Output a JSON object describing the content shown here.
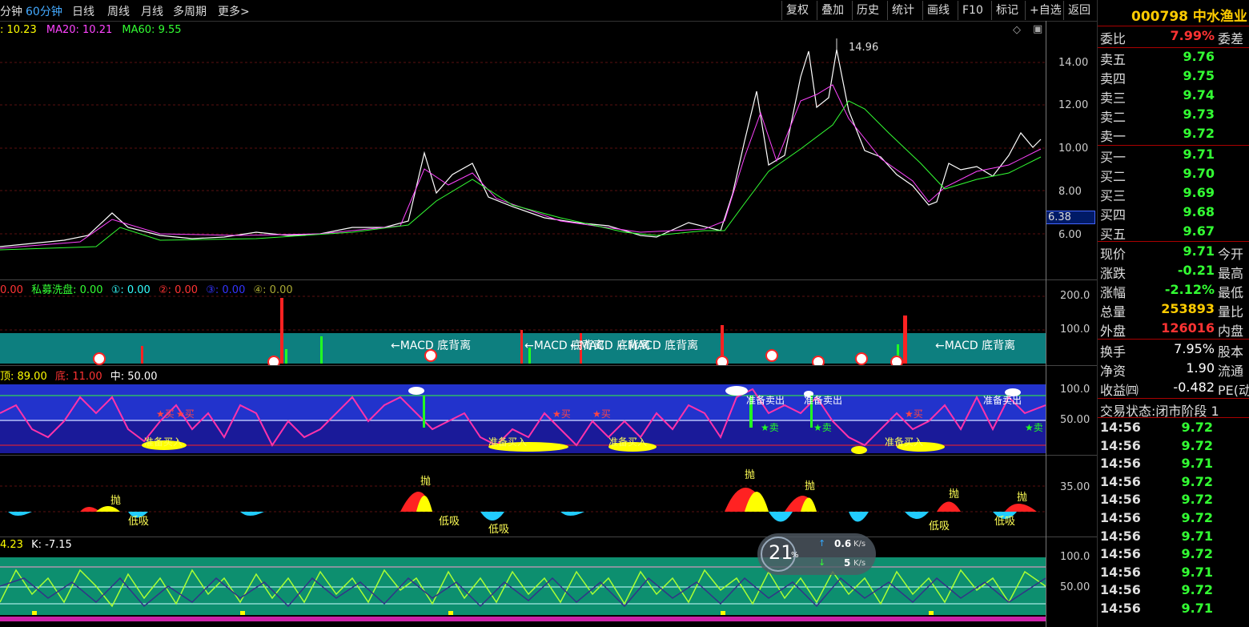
{
  "toolbar": {
    "tabs": [
      "分钟",
      "60分钟",
      "日线",
      "周线",
      "月线",
      "多周期",
      "更多>"
    ],
    "buttons": [
      "复权",
      "叠加",
      "历史",
      "统计",
      "画线",
      "F10",
      "标记",
      "+自选",
      "返回"
    ]
  },
  "main_chart": {
    "legend": [
      {
        "text": ": 10.23",
        "color": "#ffff00"
      },
      {
        "text": "MA20: 10.21",
        "color": "#ff44ff"
      },
      {
        "text": "MA60: 9.55",
        "color": "#33ff33"
      }
    ],
    "peak_label": "14.96",
    "y_ticks": [
      "14.00",
      "12.00",
      "10.00",
      "8.00",
      "6.00"
    ],
    "current_price_tag": "6.38"
  },
  "panel2": {
    "legend": [
      {
        "text": "0.00",
        "color": "#ff3333"
      },
      {
        "text": "私募洗盘: 0.00",
        "color": "#33ff33"
      },
      {
        "text": "①: 0.00",
        "color": "#33ffff"
      },
      {
        "text": "②: 0.00",
        "color": "#ff3333"
      },
      {
        "text": "③: 0.00",
        "color": "#3333ff"
      },
      {
        "text": "④: 0.00",
        "color": "#aaaa33"
      }
    ],
    "y_ticks": [
      "200.0",
      "100.0"
    ],
    "annotations": [
      "←MACD 底背离",
      "←MACD 底背离",
      "←MACD 底背离",
      "←MACD 底背离",
      "←MACD 底背离"
    ]
  },
  "panel3": {
    "legend": [
      {
        "text": "顶: 89.00",
        "color": "#ffff00"
      },
      {
        "text": "底: 11.00",
        "color": "#ff3333"
      },
      {
        "text": "中: 50.00",
        "color": "#ffffff"
      }
    ],
    "y_ticks": [
      "100.0",
      "50.00"
    ],
    "labels": {
      "buy": "准备买入",
      "sell": "准备卖出",
      "b": "★买",
      "s": "★卖"
    }
  },
  "panel4": {
    "y_ticks": [
      "35.00"
    ],
    "labels": {
      "throw": "抛",
      "absorb": "低吸"
    }
  },
  "panel5": {
    "legend": [
      {
        "text": "4.23",
        "color": "#ffff00"
      },
      {
        "text": "K: -7.15",
        "color": "#ffffff"
      }
    ],
    "y_ticks": [
      "100.0",
      "50.00"
    ]
  },
  "speed_widget": {
    "percent": "21",
    "unit": "%",
    "up": "0.6",
    "down": "5",
    "unit_rate": "K/s"
  },
  "quote": {
    "code_name": "000798 中水渔业",
    "weibi_label": "委比",
    "weibi_value": "7.99%",
    "weicha_label": "委差",
    "asks": [
      {
        "label": "卖五",
        "price": "9.76"
      },
      {
        "label": "卖四",
        "price": "9.75"
      },
      {
        "label": "卖三",
        "price": "9.74"
      },
      {
        "label": "卖二",
        "price": "9.73"
      },
      {
        "label": "卖一",
        "price": "9.72"
      }
    ],
    "bids": [
      {
        "label": "买一",
        "price": "9.71"
      },
      {
        "label": "买二",
        "price": "9.70"
      },
      {
        "label": "买三",
        "price": "9.69"
      },
      {
        "label": "买四",
        "price": "9.68"
      },
      {
        "label": "买五",
        "price": "9.67"
      }
    ],
    "stats": [
      {
        "label": "现价",
        "value": "9.71",
        "color": "#33ff33",
        "extra": "今开"
      },
      {
        "label": "涨跌",
        "value": "-0.21",
        "color": "#33ff33",
        "extra": "最高"
      },
      {
        "label": "涨幅",
        "value": "-2.12%",
        "color": "#33ff33",
        "extra": "最低"
      },
      {
        "label": "总量",
        "value": "253893",
        "color": "#ffff00",
        "extra": "量比"
      },
      {
        "label": "外盘",
        "value": "126016",
        "color": "#ff3333",
        "extra": "内盘"
      }
    ],
    "stats2": [
      {
        "label": "换手",
        "value": "7.95%",
        "extra": "股本"
      },
      {
        "label": "净资",
        "value": "1.90",
        "extra": "流通"
      },
      {
        "label": "收益㈣",
        "value": "-0.482",
        "extra": "PE(动"
      }
    ],
    "trade_status": "交易状态:闭市阶段 1",
    "ticks": [
      {
        "time": "14:56",
        "price": "9.72",
        "color": "#33ff33"
      },
      {
        "time": "14:56",
        "price": "9.72",
        "color": "#33ff33"
      },
      {
        "time": "14:56",
        "price": "9.71",
        "color": "#33ff33"
      },
      {
        "time": "14:56",
        "price": "9.72",
        "color": "#33ff33"
      },
      {
        "time": "14:56",
        "price": "9.72",
        "color": "#33ff33"
      },
      {
        "time": "14:56",
        "price": "9.72",
        "color": "#33ff33"
      },
      {
        "time": "14:56",
        "price": "9.71",
        "color": "#33ff33"
      },
      {
        "time": "14:56",
        "price": "9.72",
        "color": "#33ff33"
      },
      {
        "time": "14:56",
        "price": "9.71",
        "color": "#33ff33"
      },
      {
        "time": "14:56",
        "price": "9.72",
        "color": "#33ff33"
      },
      {
        "time": "14:56",
        "price": "9.71",
        "color": "#33ff33"
      }
    ]
  }
}
